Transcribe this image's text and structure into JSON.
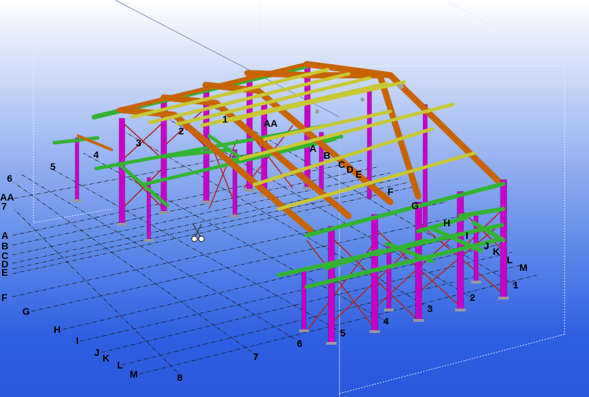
{
  "viewport": {
    "background_top": "#ffffff",
    "background_bottom": "#2a57dc"
  },
  "colors": {
    "column": "#c800c8",
    "rafter": "#c86400",
    "purlin": "#c8c832",
    "beam": "#32b432",
    "brace": "#b42828",
    "grid_line": "#1a1a1a",
    "work_area": "#e6f0ff"
  },
  "grid_labels": {
    "letters_left": [
      "AA",
      "A",
      "B",
      "C",
      "D",
      "E",
      "F",
      "G",
      "H",
      "I",
      "J",
      "K",
      "L",
      "M"
    ],
    "numbers_left": [
      "6",
      "7",
      "5",
      "4",
      "3",
      "2",
      "1"
    ],
    "letters_model": [
      "AA",
      "A",
      "B",
      "C",
      "D",
      "E",
      "F",
      "G",
      "H",
      "I",
      "J",
      "K",
      "L",
      "M"
    ],
    "numbers_front": [
      "8",
      "7",
      "6",
      "5",
      "4",
      "3",
      "2",
      "1"
    ]
  },
  "cursor": {
    "icon": "scissors-icon"
  }
}
